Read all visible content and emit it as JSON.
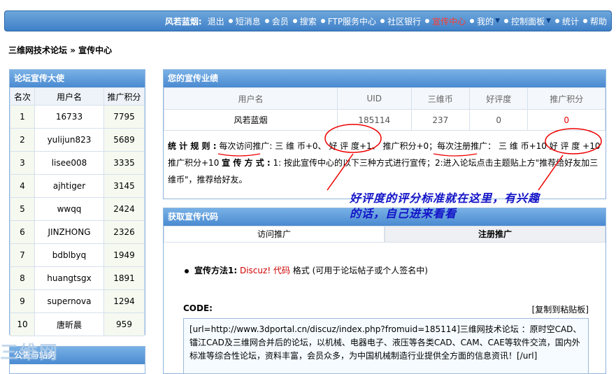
{
  "topnav": {
    "user": "风若蓝烟:",
    "items": [
      "退出",
      "短消息",
      "会员",
      "搜索",
      "FTP服务中心",
      "社区银行",
      "宣传中心",
      "我的",
      "控制面板",
      "统计",
      "帮助"
    ]
  },
  "breadcrumb": {
    "forum": "三维网技术论坛",
    "sep": "»",
    "current": "宣传中心"
  },
  "left": {
    "title": "论坛宣传大使",
    "headers": [
      "名次",
      "用户名",
      "推广积分"
    ],
    "rows": [
      {
        "rank": "1",
        "name": "16733",
        "pts": "7795"
      },
      {
        "rank": "2",
        "name": "yulijun823",
        "pts": "5689"
      },
      {
        "rank": "3",
        "name": "lisee008",
        "pts": "3335"
      },
      {
        "rank": "4",
        "name": "ajhtiger",
        "pts": "3145"
      },
      {
        "rank": "5",
        "name": "wwqq",
        "pts": "2424"
      },
      {
        "rank": "6",
        "name": "JINZHONG",
        "pts": "2326"
      },
      {
        "rank": "7",
        "name": "bdblbyq",
        "pts": "1949"
      },
      {
        "rank": "8",
        "name": "huangtsgx",
        "pts": "1891"
      },
      {
        "rank": "9",
        "name": "supernova",
        "pts": "1294"
      },
      {
        "rank": "10",
        "name": "唐昕晨",
        "pts": "959"
      }
    ],
    "title2": "公告与站务",
    "watermark": "三维网"
  },
  "perf": {
    "title": "您的宣传业绩",
    "headers": [
      "用户名",
      "UID",
      "三维币",
      "好评度",
      "推广积分"
    ],
    "row": {
      "name": "风若蓝烟",
      "uid": "185114",
      "coin": "237",
      "rating": "0",
      "pts": "0"
    },
    "rules_label": "统 计 规 则 :",
    "rules_text": "每次访问推广: 三 维 币+0、 好 评 度+1、 推广积分+0；每次注册推广： 三 维 币+10 好 评 度 +10 推广积分+10",
    "method_label": "宣 传 方 式 :",
    "method_text": "1: 按此宣传中心的以下三种方式进行宣传；2:进入论坛点击主题贴上方\"推荐给好友加三维币\"，推荐给好友。"
  },
  "annotation": "好评度的评分标准就在这里，有兴趣的话，自己进来看看",
  "code": {
    "title": "获取宣传代码",
    "tabs": [
      "访问推广",
      "注册推广"
    ],
    "method_label": "宣传方法1:",
    "method_link": "Discuz! 代码",
    "method_rest": "格式 (可用于论坛帖子或个人签名中)",
    "code_label": "CODE:",
    "copy": "[复制到粘贴板]",
    "code_text": "[url=http://www.3dportal.cn/discuz/index.php?fromuid=185114]三维网技术论坛 ：原时空CAD、镭江CAD及三维网合并后的论坛，以机械、电器电子、液压等各类CAD、CAM、CAE等软件交流，国内外标准等综合性论坛，资料丰富，会员众多，为中国机械制造行业提供全方面的信息资讯！[/url]"
  },
  "colors": {
    "nav_bg": "#4f8fd2",
    "active_nav": "#ff3b2f",
    "annotation": "#1414c8",
    "mark": "#e00000"
  }
}
